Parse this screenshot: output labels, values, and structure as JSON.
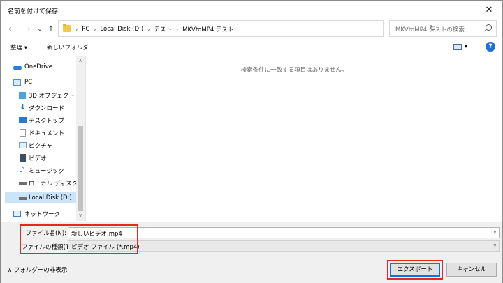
{
  "window": {
    "title": "名前を付けて保存",
    "close_glyph": "✕"
  },
  "nav": {
    "back_glyph": "←",
    "forward_glyph": "→",
    "recent_glyph": "⌄",
    "up_glyph": "↑"
  },
  "address": {
    "crumbs": [
      "PC",
      "Local Disk (D:)",
      "テスト",
      "MKVtoMP4 テスト"
    ],
    "separator": "›",
    "dropdown_glyph": "⌄",
    "refresh_glyph": "↻"
  },
  "search": {
    "placeholder": "MKVtoMP4 テストの検索",
    "icon": "search-icon"
  },
  "toolbar": {
    "organize_label": "整理 ▾",
    "new_folder_label": "新しいフォルダー",
    "view_dd": "▾",
    "help_glyph": "?"
  },
  "sidebar": {
    "items": [
      {
        "label": "OneDrive",
        "icon": "cloud-icon",
        "color": "#2a7fd4"
      },
      {
        "label": "PC",
        "icon": "computer-icon",
        "color": "#4a90d9"
      },
      {
        "label": "3D オブジェクト",
        "icon": "cube-icon",
        "color": "#4aa3df"
      },
      {
        "label": "ダウンロード",
        "icon": "download-icon",
        "color": "#2f6fb5"
      },
      {
        "label": "デスクトップ",
        "icon": "desktop-icon",
        "color": "#2b78d0"
      },
      {
        "label": "ドキュメント",
        "icon": "document-icon",
        "color": "#9a9a9a"
      },
      {
        "label": "ピクチャ",
        "icon": "pictures-icon",
        "color": "#6aa2d8"
      },
      {
        "label": "ビデオ",
        "icon": "video-icon",
        "color": "#3f4f63"
      },
      {
        "label": "ミュージック",
        "icon": "music-icon",
        "color": "#2f7fd0"
      },
      {
        "label": "ローカル ディスク (C",
        "icon": "drive-icon",
        "color": "#6f6f6f"
      },
      {
        "label": "Local Disk (D:)",
        "icon": "drive-icon",
        "color": "#6f6f6f"
      },
      {
        "label": "ネットワーク",
        "icon": "network-icon",
        "color": "#3c82c8"
      }
    ],
    "scroll_up": "∧",
    "scroll_down": "∨"
  },
  "content": {
    "empty_message": "検索条件に一致する項目はありません。"
  },
  "file": {
    "name_label": "ファイル名(N):",
    "name_value": "新しいビデオ.mp4",
    "type_label": "ファイルの種類(T):",
    "type_value": "ビデオ ファイル (*.mp4)",
    "dd_glyph": "∨"
  },
  "footer": {
    "hide_folders_label": "∧  フォルダーの非表示",
    "export_label": "エクスポート",
    "cancel_label": "キャンセル"
  },
  "colors": {
    "highlight": "#e8281e",
    "accent": "#0078d7",
    "selection": "#cce4f7"
  }
}
